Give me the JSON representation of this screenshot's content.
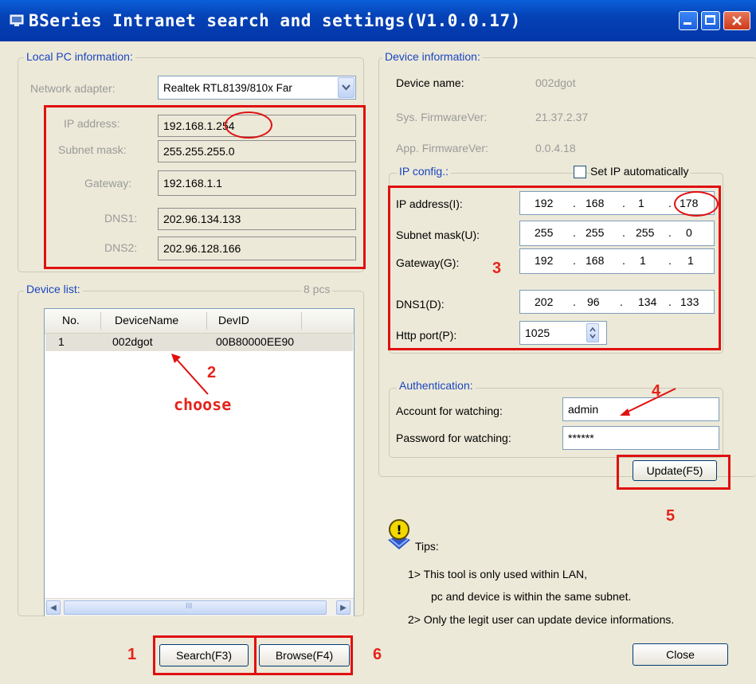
{
  "window": {
    "title": "BSeries Intranet search and settings(V1.0.0.17)"
  },
  "local_pc": {
    "group_title": "Local PC information:",
    "network_adapter_label": "Network adapter:",
    "network_adapter_value": "Realtek RTL8139/810x Far",
    "ip_label": "IP address:",
    "ip_value": "192.168.1.254",
    "subnet_label": "Subnet mask:",
    "subnet_value": "255.255.255.0",
    "gateway_label": "Gateway:",
    "gateway_value": "192.168.1.1",
    "dns1_label": "DNS1:",
    "dns1_value": "202.96.134.133",
    "dns2_label": "DNS2:",
    "dns2_value": "202.96.128.166"
  },
  "device_list": {
    "group_title": "Device list:",
    "count": "8 pcs",
    "columns": [
      "No.",
      "DeviceName",
      "DevID"
    ],
    "rows": [
      [
        "1",
        "002dgot",
        "00B80000EE90"
      ]
    ],
    "scroll_mid": "III"
  },
  "device_info": {
    "group_title": "Device information:",
    "name_label": "Device name:",
    "name_value": "002dgot",
    "sys_fw_label": "Sys. FirmwareVer:",
    "sys_fw_value": "21.37.2.37",
    "app_fw_label": "App. FirmwareVer:",
    "app_fw_value": "0.0.4.18"
  },
  "ip_config": {
    "group_title": "IP config.:",
    "auto_label": "Set IP automatically",
    "ip_label": "IP address(I):",
    "ip": [
      "192",
      "168",
      "1",
      "178"
    ],
    "subnet_label": "Subnet mask(U):",
    "subnet": [
      "255",
      "255",
      "255",
      "0"
    ],
    "gateway_label": "Gateway(G):",
    "gateway": [
      "192",
      "168",
      "1",
      "1"
    ],
    "dns1_label": "DNS1(D):",
    "dns1": [
      "202",
      "96",
      "134",
      "133"
    ],
    "http_label": "Http port(P):",
    "http_value": "1025",
    "dot": "."
  },
  "auth": {
    "group_title": "Authentication:",
    "account_label": "Account for watching:",
    "account_value": "admin",
    "password_label": "Password for watching:",
    "password_value": "******"
  },
  "buttons": {
    "update": "Update(F5)",
    "search": "Search(F3)",
    "browse": "Browse(F4)",
    "close": "Close"
  },
  "tips": {
    "title": "Tips:",
    "line1": "1> This tool is only used within LAN,",
    "line2": "pc and device is within the same subnet.",
    "line3": "2> Only the legit user can update  device informations."
  },
  "annotations": {
    "n1": "1",
    "n2": "2",
    "n3": "3",
    "n4": "4",
    "n5": "5",
    "n6": "6",
    "choose": "choose",
    "color": "#e01010"
  }
}
